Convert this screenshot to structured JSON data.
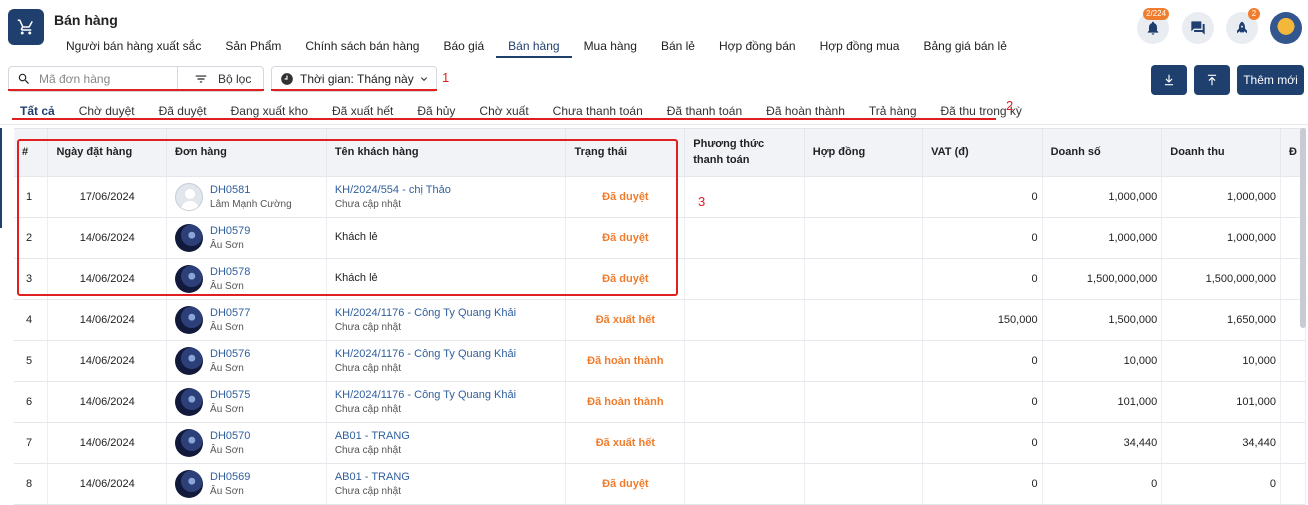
{
  "header": {
    "title": "Bán hàng",
    "nav": [
      "Người bán hàng xuất sắc",
      "Sản Phẩm",
      "Chính sách bán hàng",
      "Báo giá",
      "Bán hàng",
      "Mua hàng",
      "Bán lẻ",
      "Hợp đồng bán",
      "Hợp đồng mua",
      "Bảng giá bán lẻ"
    ],
    "notification_badge": "2/224",
    "rocket_badge": "2"
  },
  "toolbar": {
    "search_placeholder": "Mã đơn hàng",
    "filter_label": "Bộ lọc",
    "time_label": "Thời gian: Tháng này",
    "add_label": "Thêm mới"
  },
  "annotations": {
    "one": "1",
    "two": "2",
    "three": "3"
  },
  "status_tabs": [
    "Tất cả",
    "Chờ duyệt",
    "Đã duyệt",
    "Đang xuất kho",
    "Đã xuất hết",
    "Đã hủy",
    "Chờ xuất",
    "Chưa thanh toán",
    "Đã thanh toán",
    "Đã hoàn thành",
    "Trả hàng",
    "Đã thu trong kỳ"
  ],
  "table": {
    "headers": [
      "#",
      "Ngày đặt hàng",
      "Đơn hàng",
      "Tên khách hàng",
      "Trạng thái",
      "Phương thức thanh toán",
      "Hợp đồng",
      "VAT (đ)",
      "Doanh số",
      "Doanh thu",
      "Đ"
    ],
    "rows": [
      {
        "idx": "1",
        "date": "17/06/2024",
        "code": "DH0581",
        "seller": "Lâm Mạnh Cường",
        "customer": "KH/2024/554 - chị Thảo",
        "customer_sub": "Chưa cập nhật",
        "status": "Đã duyệt",
        "vat": "0",
        "sales": "1,000,000",
        "revenue": "1,000,000"
      },
      {
        "idx": "2",
        "date": "14/06/2024",
        "code": "DH0579",
        "seller": "Âu Sơn",
        "customer": "Khách lẻ",
        "customer_sub": "",
        "status": "Đã duyệt",
        "vat": "0",
        "sales": "1,000,000",
        "revenue": "1,000,000"
      },
      {
        "idx": "3",
        "date": "14/06/2024",
        "code": "DH0578",
        "seller": "Âu Sơn",
        "customer": "Khách lẻ",
        "customer_sub": "",
        "status": "Đã duyệt",
        "vat": "0",
        "sales": "1,500,000,000",
        "revenue": "1,500,000,000"
      },
      {
        "idx": "4",
        "date": "14/06/2024",
        "code": "DH0577",
        "seller": "Âu Sơn",
        "customer": "KH/2024/1176 - Công Ty Quang Khải",
        "customer_sub": "Chưa cập nhật",
        "status": "Đã xuất hết",
        "vat": "150,000",
        "sales": "1,500,000",
        "revenue": "1,650,000"
      },
      {
        "idx": "5",
        "date": "14/06/2024",
        "code": "DH0576",
        "seller": "Âu Sơn",
        "customer": "KH/2024/1176 - Công Ty Quang Khải",
        "customer_sub": "Chưa cập nhật",
        "status": "Đã hoàn thành",
        "vat": "0",
        "sales": "10,000",
        "revenue": "10,000"
      },
      {
        "idx": "6",
        "date": "14/06/2024",
        "code": "DH0575",
        "seller": "Âu Sơn",
        "customer": "KH/2024/1176 - Công Ty Quang Khải",
        "customer_sub": "Chưa cập nhật",
        "status": "Đã hoàn thành",
        "vat": "0",
        "sales": "101,000",
        "revenue": "101,000"
      },
      {
        "idx": "7",
        "date": "14/06/2024",
        "code": "DH0570",
        "seller": "Âu Sơn",
        "customer": "AB01 - TRANG",
        "customer_sub": "Chưa cập nhật",
        "status": "Đã xuất hết",
        "vat": "0",
        "sales": "34,440",
        "revenue": "34,440"
      },
      {
        "idx": "8",
        "date": "14/06/2024",
        "code": "DH0569",
        "seller": "Âu Sơn",
        "customer": "AB01 - TRANG",
        "customer_sub": "Chưa cập nhật",
        "status": "Đã duyệt",
        "vat": "0",
        "sales": "0",
        "revenue": "0"
      }
    ]
  },
  "colors": {
    "primary": "#1f3f6e",
    "status_orange": "#f07c2d",
    "annotation_red": "#e02020",
    "link_blue": "#2f5f9e"
  }
}
